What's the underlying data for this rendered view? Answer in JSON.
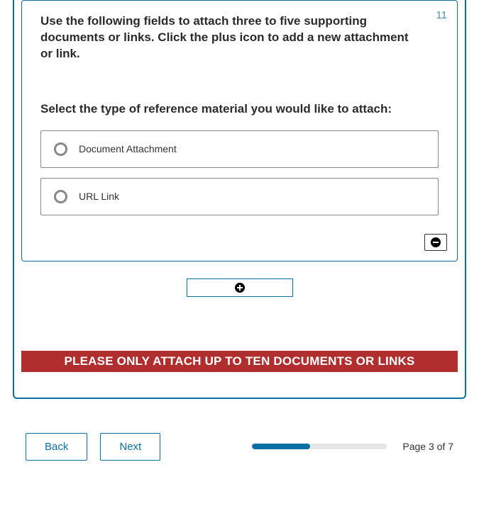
{
  "question": {
    "number": "11",
    "instruction": "Use the following fields to attach three to five supporting documents or links. Click the plus icon to add a new attachment or link.",
    "prompt": "Select the type of reference material you would like to attach:",
    "options": [
      {
        "label": "Document Attachment"
      },
      {
        "label": "URL Link"
      }
    ]
  },
  "warning": "PLEASE ONLY ATTACH UP TO TEN DOCUMENTS OR LINKS",
  "nav": {
    "back": "Back",
    "next": "Next"
  },
  "pagination": {
    "label": "Page 3 of 7",
    "progress_percent": 43
  }
}
